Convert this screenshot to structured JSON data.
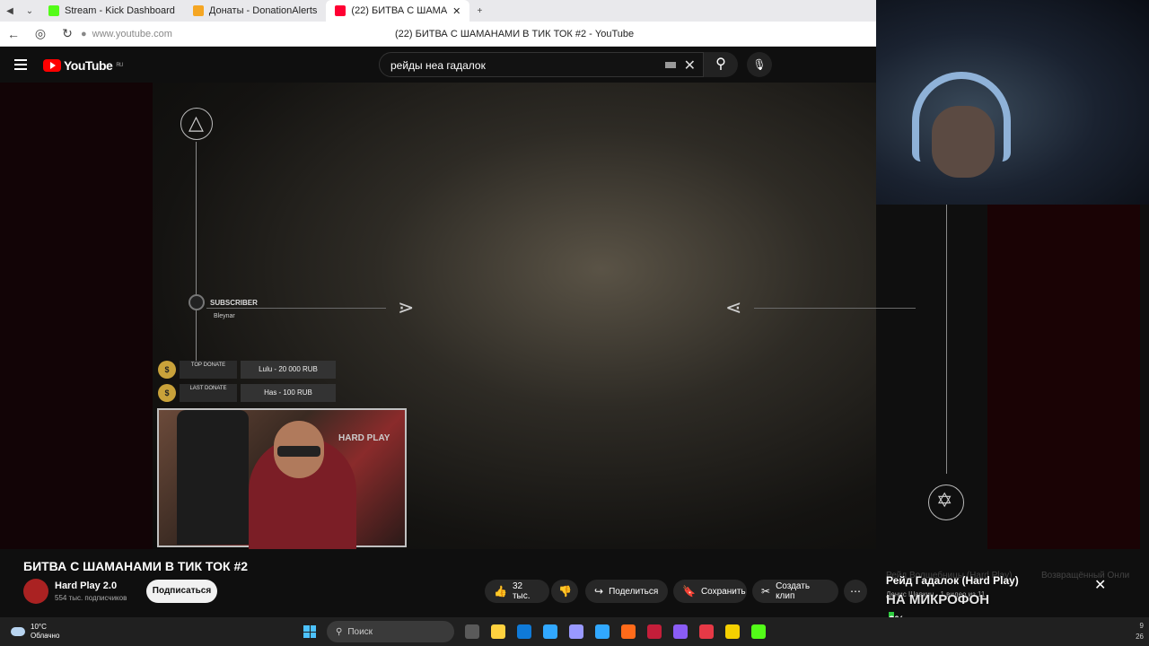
{
  "browser": {
    "tabs": [
      {
        "label": "Stream - Kick Dashboard",
        "color": "#53fc18"
      },
      {
        "label": "Донаты - DonationAlerts",
        "color": "#f5a623"
      },
      {
        "label": "(22) БИТВА С ШАМА",
        "color": "#ff0033"
      }
    ],
    "url": "www.youtube.com",
    "page_title": "(22) БИТВА С ШАМАНАМИ В ТИК ТОК #2 - YouTube"
  },
  "youtube": {
    "logo_text": "YouTube",
    "region": "RU",
    "search_value": "рейды неа гадалок"
  },
  "stream_overlay": {
    "subscriber_label": "SUBSCRIBER",
    "subscriber_name": "Bleynar",
    "top_donate_label": "TOP DONATE",
    "top_donate_value": "Lulu - 20 000 RUB",
    "last_donate_label": "LAST DONATE",
    "last_donate_value": "Has - 100 RUB",
    "cam_brand": "HARD PLAY"
  },
  "video_info": {
    "title": "БИТВА С ШАМАНАМИ В ТИК ТОК #2",
    "channel": "Hard Play 2.0",
    "subscribers": "554 тыс. подписчиков",
    "subscribe_label": "Подписаться",
    "likes": "32 тыс.",
    "share_label": "Поделиться",
    "save_label": "Сохранить",
    "clip_label": "Создать клип"
  },
  "mini_overlay": {
    "title": "Рейд Гадалок (Hard Play)",
    "subtitle": "Денис Шавкин · 1 видео из 11",
    "bg_left": "Рейд Волшебницы (Hard Play)",
    "bg_right": "Возвращённый Онли",
    "mic_label": "НА МИКРОФОН",
    "percent": "3%"
  },
  "taskbar": {
    "temperature": "10°C",
    "weather": "Облачно",
    "search_placeholder": "Поиск",
    "icon_colors": [
      "#5a5a5a",
      "#ffd23f",
      "#0f7ad8",
      "#31a8ff",
      "#9999ff",
      "#31a8ff",
      "#ff6b1a",
      "#c41e3a",
      "#8a5cf5",
      "#e63946",
      "#f5d000",
      "#53fc18"
    ]
  }
}
